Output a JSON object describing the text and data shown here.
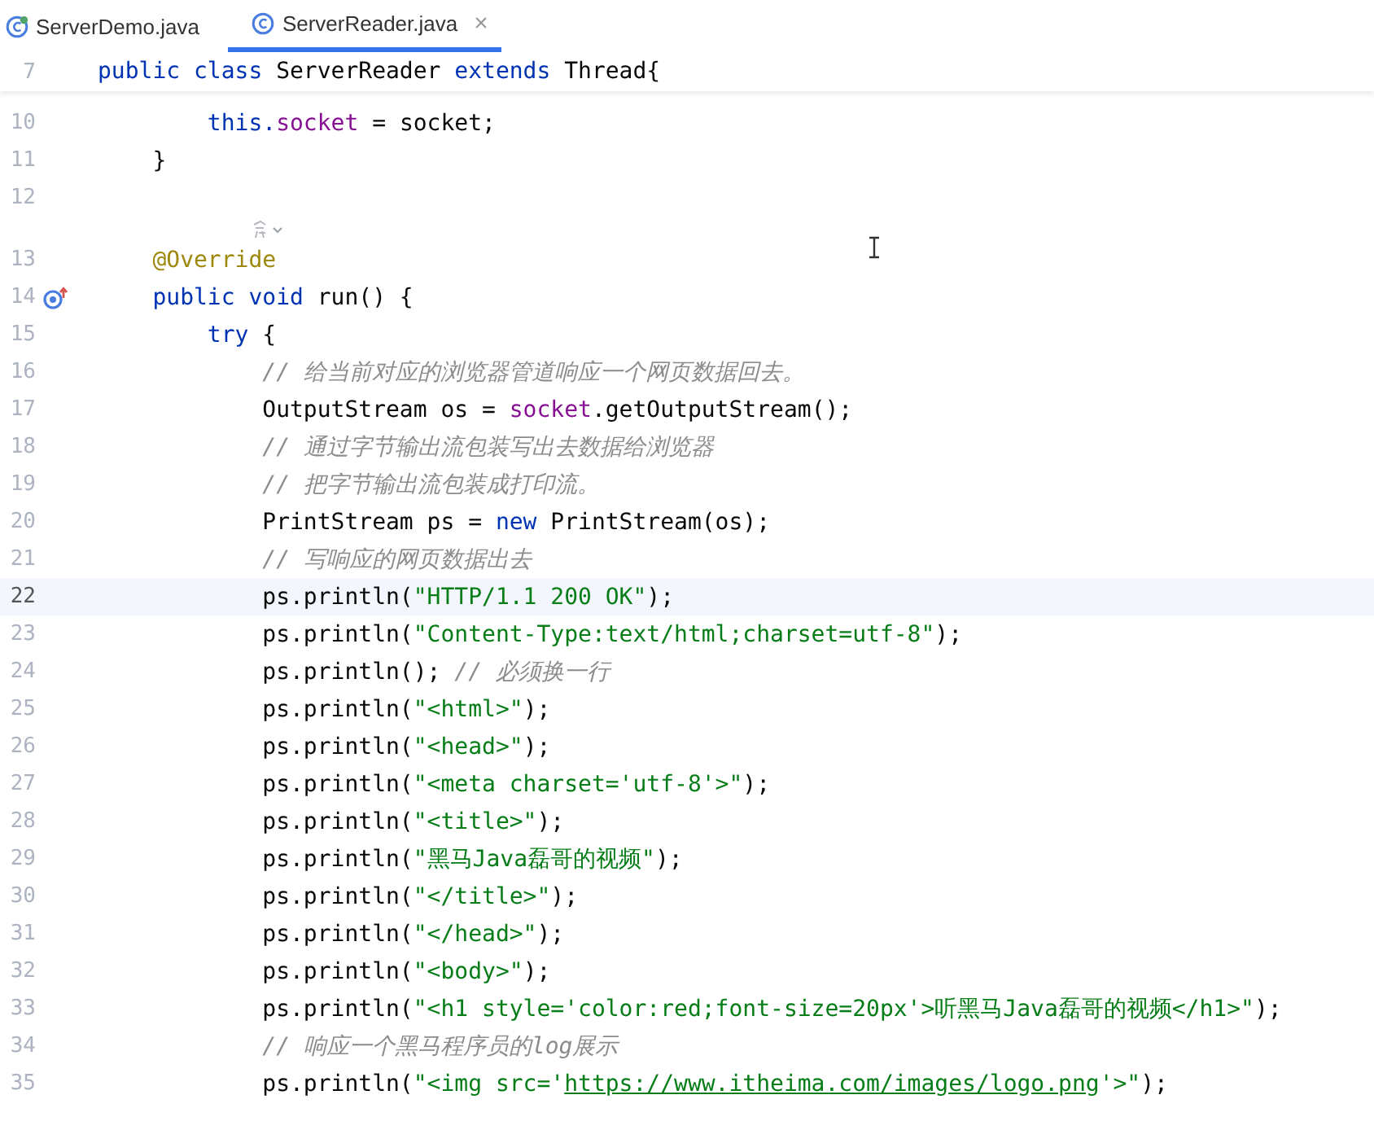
{
  "tabs": [
    {
      "label": "ServerDemo.java",
      "selected": false
    },
    {
      "label": "ServerReader.java",
      "selected": true
    }
  ],
  "close_glyph": "×",
  "sticky_line": {
    "number": "7",
    "tokens": [
      {
        "t": "public class ",
        "kind": "kw"
      },
      {
        "t": "ServerReader ",
        "kind": "plain"
      },
      {
        "t": "extends ",
        "kind": "kw"
      },
      {
        "t": "Thread{",
        "kind": "plain"
      }
    ]
  },
  "lines": [
    {
      "kind": "code",
      "number": "10",
      "current": false,
      "override": false,
      "tokens": [
        {
          "t": "        this.",
          "kind": "kw"
        },
        {
          "t": "socket",
          "kind": "field"
        },
        {
          "t": " = socket;",
          "kind": "plain"
        }
      ]
    },
    {
      "kind": "code",
      "number": "11",
      "current": false,
      "override": false,
      "tokens": [
        {
          "t": "    }",
          "kind": "plain"
        }
      ]
    },
    {
      "kind": "code",
      "number": "12",
      "current": false,
      "override": false
    },
    {
      "kind": "inlay"
    },
    {
      "kind": "code",
      "number": "13",
      "current": false,
      "override": false,
      "tokens": [
        {
          "t": "    @Override",
          "kind": "annot"
        }
      ]
    },
    {
      "kind": "code",
      "number": "14",
      "current": false,
      "override": true,
      "tokens": [
        {
          "t": "    public void ",
          "kind": "kw"
        },
        {
          "t": "run() {",
          "kind": "plain"
        }
      ]
    },
    {
      "kind": "code",
      "number": "15",
      "current": false,
      "override": false,
      "tokens": [
        {
          "t": "        try ",
          "kind": "kw"
        },
        {
          "t": "{",
          "kind": "plain"
        }
      ]
    },
    {
      "kind": "code",
      "number": "16",
      "current": false,
      "override": false,
      "tokens": [
        {
          "t": "            // 给当前对应的浏览器管道响应一个网页数据回去。",
          "kind": "comment"
        }
      ]
    },
    {
      "kind": "code",
      "number": "17",
      "current": false,
      "override": false,
      "tokens": [
        {
          "t": "            OutputStream os = ",
          "kind": "plain"
        },
        {
          "t": "socket",
          "kind": "field"
        },
        {
          "t": ".getOutputStream();",
          "kind": "plain"
        }
      ]
    },
    {
      "kind": "code",
      "number": "18",
      "current": false,
      "override": false,
      "tokens": [
        {
          "t": "            // 通过字节输出流包装写出去数据给浏览器",
          "kind": "comment"
        }
      ]
    },
    {
      "kind": "code",
      "number": "19",
      "current": false,
      "override": false,
      "tokens": [
        {
          "t": "            // 把字节输出流包装成打印流。",
          "kind": "comment"
        }
      ]
    },
    {
      "kind": "code",
      "number": "20",
      "current": false,
      "override": false,
      "tokens": [
        {
          "t": "            PrintStream ps = ",
          "kind": "plain"
        },
        {
          "t": "new ",
          "kind": "kw"
        },
        {
          "t": "PrintStream(os);",
          "kind": "plain"
        }
      ]
    },
    {
      "kind": "code",
      "number": "21",
      "current": false,
      "override": false,
      "tokens": [
        {
          "t": "            // 写响应的网页数据出去",
          "kind": "comment"
        }
      ]
    },
    {
      "kind": "code",
      "number": "22",
      "current": true,
      "override": false,
      "tokens": [
        {
          "t": "            ps.println(",
          "kind": "plain"
        },
        {
          "t": "\"HTTP/1.1 200 OK\"",
          "kind": "str"
        },
        {
          "t": ");",
          "kind": "plain"
        }
      ]
    },
    {
      "kind": "code",
      "number": "23",
      "current": false,
      "override": false,
      "tokens": [
        {
          "t": "            ps.println(",
          "kind": "plain"
        },
        {
          "t": "\"Content-Type:text/html;charset=utf-8\"",
          "kind": "str"
        },
        {
          "t": ");",
          "kind": "plain"
        }
      ]
    },
    {
      "kind": "code",
      "number": "24",
      "current": false,
      "override": false,
      "tokens": [
        {
          "t": "            ps.println(); ",
          "kind": "plain"
        },
        {
          "t": "// 必须换一行",
          "kind": "comment"
        }
      ]
    },
    {
      "kind": "code",
      "number": "25",
      "current": false,
      "override": false,
      "tokens": [
        {
          "t": "            ps.println(",
          "kind": "plain"
        },
        {
          "t": "\"<html>\"",
          "kind": "str"
        },
        {
          "t": ");",
          "kind": "plain"
        }
      ]
    },
    {
      "kind": "code",
      "number": "26",
      "current": false,
      "override": false,
      "tokens": [
        {
          "t": "            ps.println(",
          "kind": "plain"
        },
        {
          "t": "\"<head>\"",
          "kind": "str"
        },
        {
          "t": ");",
          "kind": "plain"
        }
      ]
    },
    {
      "kind": "code",
      "number": "27",
      "current": false,
      "override": false,
      "tokens": [
        {
          "t": "            ps.println(",
          "kind": "plain"
        },
        {
          "t": "\"<meta charset='utf-8'>\"",
          "kind": "str"
        },
        {
          "t": ");",
          "kind": "plain"
        }
      ]
    },
    {
      "kind": "code",
      "number": "28",
      "current": false,
      "override": false,
      "tokens": [
        {
          "t": "            ps.println(",
          "kind": "plain"
        },
        {
          "t": "\"<title>\"",
          "kind": "str"
        },
        {
          "t": ");",
          "kind": "plain"
        }
      ]
    },
    {
      "kind": "code",
      "number": "29",
      "current": false,
      "override": false,
      "tokens": [
        {
          "t": "            ps.println(",
          "kind": "plain"
        },
        {
          "t": "\"黑马Java磊哥的视频\"",
          "kind": "str"
        },
        {
          "t": ");",
          "kind": "plain"
        }
      ]
    },
    {
      "kind": "code",
      "number": "30",
      "current": false,
      "override": false,
      "tokens": [
        {
          "t": "            ps.println(",
          "kind": "plain"
        },
        {
          "t": "\"</title>\"",
          "kind": "str"
        },
        {
          "t": ");",
          "kind": "plain"
        }
      ]
    },
    {
      "kind": "code",
      "number": "31",
      "current": false,
      "override": false,
      "tokens": [
        {
          "t": "            ps.println(",
          "kind": "plain"
        },
        {
          "t": "\"</head>\"",
          "kind": "str"
        },
        {
          "t": ");",
          "kind": "plain"
        }
      ]
    },
    {
      "kind": "code",
      "number": "32",
      "current": false,
      "override": false,
      "tokens": [
        {
          "t": "            ps.println(",
          "kind": "plain"
        },
        {
          "t": "\"<body>\"",
          "kind": "str"
        },
        {
          "t": ");",
          "kind": "plain"
        }
      ]
    },
    {
      "kind": "code",
      "number": "33",
      "current": false,
      "override": false,
      "tokens": [
        {
          "t": "            ps.println(",
          "kind": "plain"
        },
        {
          "t": "\"<h1 style='color:red;font-size=20px'>听黑马Java磊哥的视频</h1>\"",
          "kind": "str"
        },
        {
          "t": ");",
          "kind": "plain"
        }
      ]
    },
    {
      "kind": "code",
      "number": "34",
      "current": false,
      "override": false,
      "tokens": [
        {
          "t": "            // 响应一个黑马程序员的log展示",
          "kind": "comment"
        }
      ]
    },
    {
      "kind": "code",
      "number": "35",
      "current": false,
      "override": false,
      "tokens": [
        {
          "t": "            ps.println(",
          "kind": "plain"
        },
        {
          "t": "\"<img src='",
          "kind": "str"
        },
        {
          "t": "https://www.itheima.com/images/logo.png",
          "kind": "link"
        },
        {
          "t": "'>\"",
          "kind": "str"
        },
        {
          "t": ");",
          "kind": "plain"
        }
      ]
    }
  ]
}
